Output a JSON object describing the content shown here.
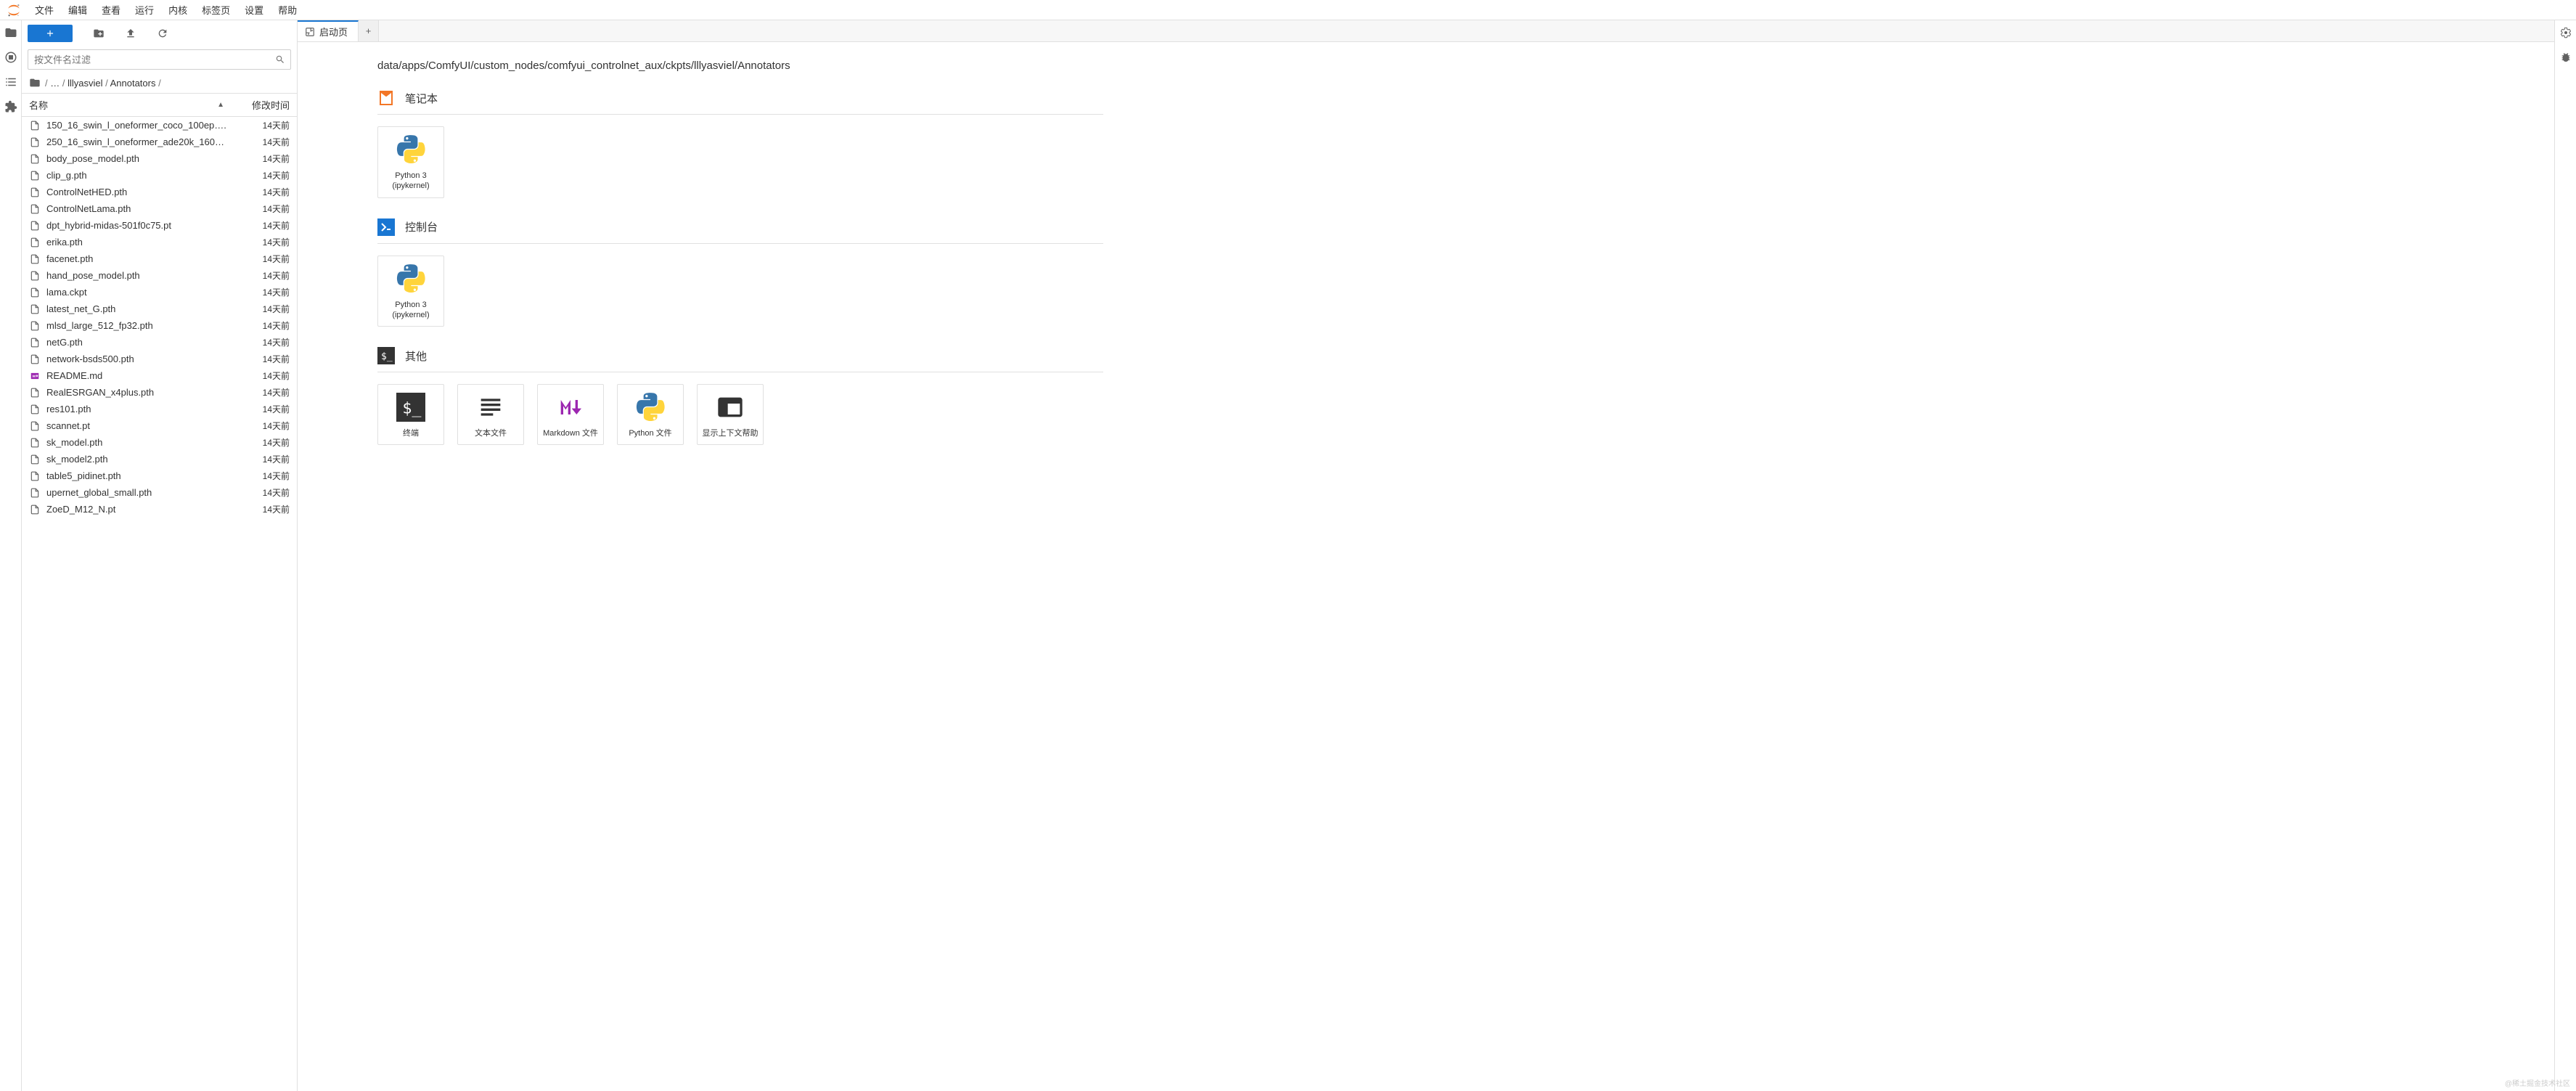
{
  "menu": [
    "文件",
    "编辑",
    "查看",
    "运行",
    "内核",
    "标签页",
    "设置",
    "帮助"
  ],
  "filebrowser": {
    "filter_placeholder": "按文件名过滤",
    "breadcrumb": [
      "",
      "…",
      "lllyasviel",
      "Annotators",
      ""
    ],
    "header_name": "名称",
    "header_modified": "修改时间",
    "files": [
      {
        "name": "150_16_swin_l_oneformer_coco_100ep….",
        "mod": "14天前",
        "icon": "file"
      },
      {
        "name": "250_16_swin_l_oneformer_ade20k_160…",
        "mod": "14天前",
        "icon": "file"
      },
      {
        "name": "body_pose_model.pth",
        "mod": "14天前",
        "icon": "file"
      },
      {
        "name": "clip_g.pth",
        "mod": "14天前",
        "icon": "file"
      },
      {
        "name": "ControlNetHED.pth",
        "mod": "14天前",
        "icon": "file"
      },
      {
        "name": "ControlNetLama.pth",
        "mod": "14天前",
        "icon": "file"
      },
      {
        "name": "dpt_hybrid-midas-501f0c75.pt",
        "mod": "14天前",
        "icon": "file"
      },
      {
        "name": "erika.pth",
        "mod": "14天前",
        "icon": "file"
      },
      {
        "name": "facenet.pth",
        "mod": "14天前",
        "icon": "file"
      },
      {
        "name": "hand_pose_model.pth",
        "mod": "14天前",
        "icon": "file"
      },
      {
        "name": "lama.ckpt",
        "mod": "14天前",
        "icon": "file"
      },
      {
        "name": "latest_net_G.pth",
        "mod": "14天前",
        "icon": "file"
      },
      {
        "name": "mlsd_large_512_fp32.pth",
        "mod": "14天前",
        "icon": "file"
      },
      {
        "name": "netG.pth",
        "mod": "14天前",
        "icon": "file"
      },
      {
        "name": "network-bsds500.pth",
        "mod": "14天前",
        "icon": "file"
      },
      {
        "name": "README.md",
        "mod": "14天前",
        "icon": "md"
      },
      {
        "name": "RealESRGAN_x4plus.pth",
        "mod": "14天前",
        "icon": "file"
      },
      {
        "name": "res101.pth",
        "mod": "14天前",
        "icon": "file"
      },
      {
        "name": "scannet.pt",
        "mod": "14天前",
        "icon": "file"
      },
      {
        "name": "sk_model.pth",
        "mod": "14天前",
        "icon": "file"
      },
      {
        "name": "sk_model2.pth",
        "mod": "14天前",
        "icon": "file"
      },
      {
        "name": "table5_pidinet.pth",
        "mod": "14天前",
        "icon": "file"
      },
      {
        "name": "upernet_global_small.pth",
        "mod": "14天前",
        "icon": "file"
      },
      {
        "name": "ZoeD_M12_N.pt",
        "mod": "14天前",
        "icon": "file"
      }
    ]
  },
  "tab": {
    "label": "启动页"
  },
  "launcher": {
    "path": "data/apps/ComfyUI/custom_nodes/comfyui_controlnet_aux/ckpts/lllyasviel/Annotators",
    "sections": {
      "notebook": {
        "title": "笔记本",
        "cards": [
          {
            "label_line1": "Python 3",
            "label_line2": "(ipykernel)",
            "kind": "python"
          }
        ]
      },
      "console": {
        "title": "控制台",
        "cards": [
          {
            "label_line1": "Python 3",
            "label_line2": "(ipykernel)",
            "kind": "python"
          }
        ]
      },
      "other": {
        "title": "其他",
        "cards": [
          {
            "label_line1": "终端",
            "kind": "terminal"
          },
          {
            "label_line1": "文本文件",
            "kind": "text"
          },
          {
            "label_line1": "Markdown 文件",
            "kind": "markdown"
          },
          {
            "label_line1": "Python 文件",
            "kind": "python"
          },
          {
            "label_line1": "显示上下文帮助",
            "kind": "help"
          }
        ]
      }
    }
  },
  "watermark": "@稀土掘金技术社区"
}
